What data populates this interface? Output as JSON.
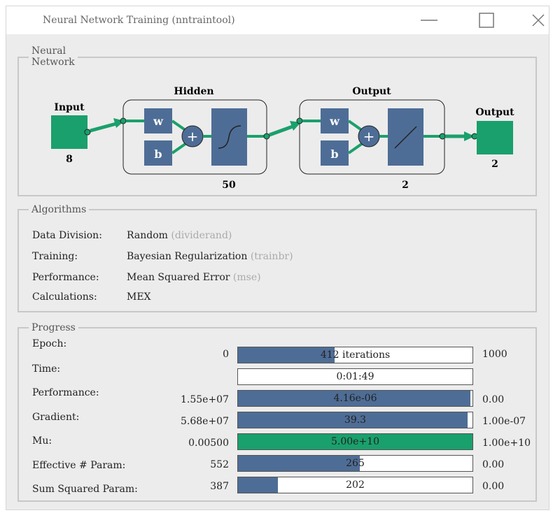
{
  "window": {
    "title": "Neural Network Training (nntraintool)"
  },
  "network": {
    "legend_line1": "Neural",
    "legend_line2": "Network",
    "input_label": "Input",
    "input_size": "8",
    "hidden_label": "Hidden",
    "hidden_size": "50",
    "output_layer_label": "Output",
    "output_layer_size": "2",
    "output_label": "Output",
    "output_size": "2",
    "weight_symbol": "w",
    "bias_symbol": "b",
    "sum_symbol": "+",
    "colors": {
      "block": "#4e6d96",
      "io": "#1aa06c",
      "arrow": "#1aa06c"
    }
  },
  "algorithms": {
    "legend": "Algorithms",
    "rows": [
      {
        "label": "Data Division:",
        "value": "Random",
        "hint": "(dividerand)"
      },
      {
        "label": "Training:",
        "value": "Bayesian Regularization",
        "hint": "(trainbr)"
      },
      {
        "label": "Performance:",
        "value": "Mean Squared Error",
        "hint": "(mse)"
      },
      {
        "label": "Calculations:",
        "value": "MEX",
        "hint": ""
      }
    ]
  },
  "progress": {
    "legend": "Progress",
    "rows": [
      {
        "label": "Epoch:",
        "start": "0",
        "current": "412 iterations",
        "end": "1000",
        "fill": 0.412,
        "color": "#4e6d96"
      },
      {
        "label": "Time:",
        "start": "",
        "current": "0:01:49",
        "end": "",
        "fill": 0,
        "color": "#4e6d96"
      },
      {
        "label": "Performance:",
        "start": "1.55e+07",
        "current": "4.16e-06",
        "end": "0.00",
        "fill": 0.99,
        "color": "#4e6d96"
      },
      {
        "label": "Gradient:",
        "start": "5.68e+07",
        "current": "39.3",
        "end": "1.00e-07",
        "fill": 0.98,
        "color": "#4e6d96"
      },
      {
        "label": "Mu:",
        "start": "0.00500",
        "current": "5.00e+10",
        "end": "1.00e+10",
        "fill": 1.0,
        "color": "#1aa06c"
      },
      {
        "label": "Effective # Param:",
        "start": "552",
        "current": "265",
        "end": "0.00",
        "fill": 0.52,
        "color": "#4e6d96"
      },
      {
        "label": "Sum Squared Param:",
        "start": "387",
        "current": "202",
        "end": "0.00",
        "fill": 0.17,
        "color": "#4e6d96"
      }
    ]
  }
}
